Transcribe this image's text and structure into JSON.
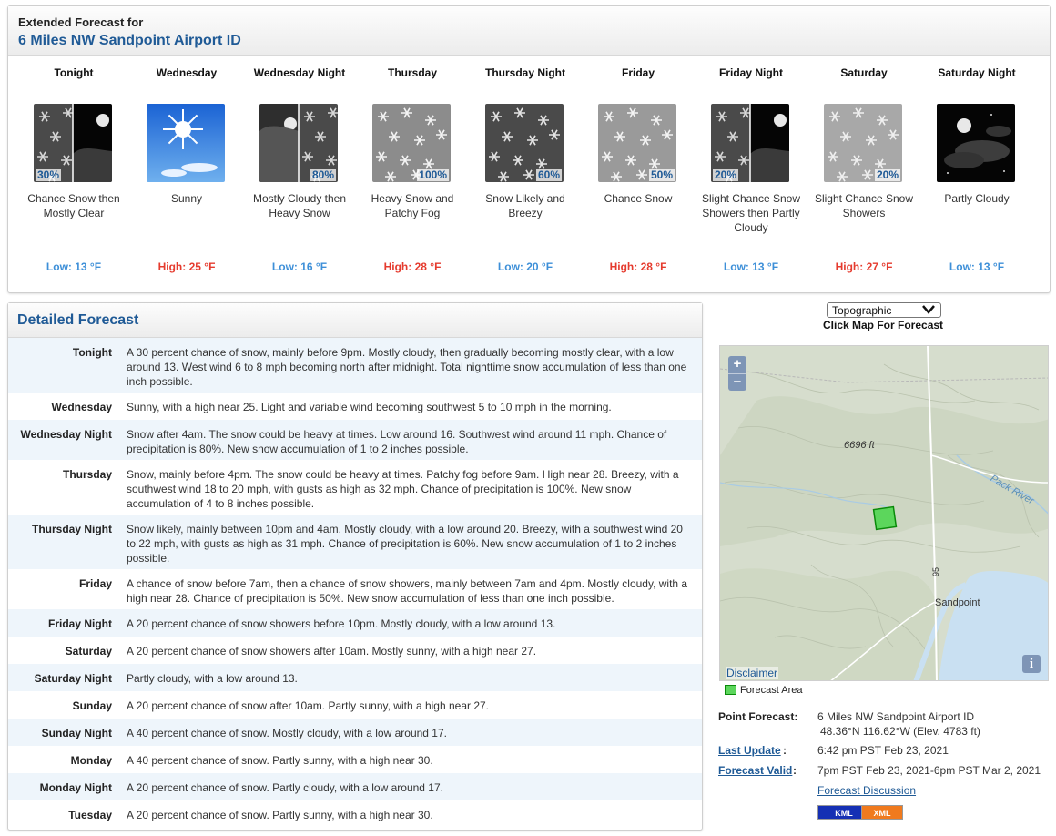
{
  "extended": {
    "label": "Extended Forecast for",
    "location": "6 Miles NW Sandpoint Airport ID",
    "periods": [
      {
        "name": "Tonight",
        "icon": "snow-then-clear-night-icon",
        "pct": "30%",
        "pct_side": "left",
        "desc": "Chance Snow then Mostly Clear",
        "temp": "Low: 13 °F",
        "temp_type": "low"
      },
      {
        "name": "Wednesday",
        "icon": "sunny-icon",
        "pct": "",
        "pct_side": "right",
        "desc": "Sunny",
        "temp": "High: 25 °F",
        "temp_type": "high"
      },
      {
        "name": "Wednesday Night",
        "icon": "cloudy-night-then-snow-icon",
        "pct": "80%",
        "pct_side": "right",
        "desc": "Mostly Cloudy then Heavy Snow",
        "temp": "Low: 16 °F",
        "temp_type": "low"
      },
      {
        "name": "Thursday",
        "icon": "heavy-snow-icon",
        "pct": "100%",
        "pct_side": "right",
        "desc": "Heavy Snow and Patchy Fog",
        "temp": "High: 28 °F",
        "temp_type": "high"
      },
      {
        "name": "Thursday Night",
        "icon": "snow-night-icon",
        "pct": "60%",
        "pct_side": "right",
        "desc": "Snow Likely and Breezy",
        "temp": "Low: 20 °F",
        "temp_type": "low"
      },
      {
        "name": "Friday",
        "icon": "snow-icon",
        "pct": "50%",
        "pct_side": "right",
        "desc": "Chance Snow",
        "temp": "High: 28 °F",
        "temp_type": "high"
      },
      {
        "name": "Friday Night",
        "icon": "snow-showers-then-partly-cloudy-night-icon",
        "pct": "20%",
        "pct_side": "left",
        "desc": "Slight Chance Snow Showers then Partly Cloudy",
        "temp": "Low: 13 °F",
        "temp_type": "low"
      },
      {
        "name": "Saturday",
        "icon": "snow-showers-icon",
        "pct": "20%",
        "pct_side": "right",
        "desc": "Slight Chance Snow Showers",
        "temp": "High: 27 °F",
        "temp_type": "high"
      },
      {
        "name": "Saturday Night",
        "icon": "partly-cloudy-night-icon",
        "pct": "",
        "pct_side": "right",
        "desc": "Partly Cloudy",
        "temp": "Low: 13 °F",
        "temp_type": "low"
      }
    ]
  },
  "detailed": {
    "title": "Detailed Forecast",
    "rows": [
      {
        "label": "Tonight",
        "text": "A 30 percent chance of snow, mainly before 9pm. Mostly cloudy, then gradually becoming mostly clear, with a low around 13. West wind 6 to 8 mph becoming north after midnight. Total nighttime snow accumulation of less than one inch possible."
      },
      {
        "label": "Wednesday",
        "text": "Sunny, with a high near 25. Light and variable wind becoming southwest 5 to 10 mph in the morning."
      },
      {
        "label": "Wednesday Night",
        "text": "Snow after 4am. The snow could be heavy at times. Low around 16. Southwest wind around 11 mph. Chance of precipitation is 80%. New snow accumulation of 1 to 2 inches possible."
      },
      {
        "label": "Thursday",
        "text": "Snow, mainly before 4pm. The snow could be heavy at times. Patchy fog before 9am. High near 28. Breezy, with a southwest wind 18 to 20 mph, with gusts as high as 32 mph. Chance of precipitation is 100%. New snow accumulation of 4 to 8 inches possible."
      },
      {
        "label": "Thursday Night",
        "text": "Snow likely, mainly between 10pm and 4am. Mostly cloudy, with a low around 20. Breezy, with a southwest wind 20 to 22 mph, with gusts as high as 31 mph. Chance of precipitation is 60%. New snow accumulation of 1 to 2 inches possible."
      },
      {
        "label": "Friday",
        "text": "A chance of snow before 7am, then a chance of snow showers, mainly between 7am and 4pm. Mostly cloudy, with a high near 28. Chance of precipitation is 50%. New snow accumulation of less than one inch possible."
      },
      {
        "label": "Friday Night",
        "text": "A 20 percent chance of snow showers before 10pm. Mostly cloudy, with a low around 13."
      },
      {
        "label": "Saturday",
        "text": "A 20 percent chance of snow showers after 10am. Mostly sunny, with a high near 27."
      },
      {
        "label": "Saturday Night",
        "text": "Partly cloudy, with a low around 13."
      },
      {
        "label": "Sunday",
        "text": "A 20 percent chance of snow after 10am. Partly sunny, with a high near 27."
      },
      {
        "label": "Sunday Night",
        "text": "A 40 percent chance of snow. Mostly cloudy, with a low around 17."
      },
      {
        "label": "Monday",
        "text": "A 40 percent chance of snow. Partly sunny, with a high near 30."
      },
      {
        "label": "Monday Night",
        "text": "A 20 percent chance of snow. Partly cloudy, with a low around 17."
      },
      {
        "label": "Tuesday",
        "text": "A 20 percent chance of snow. Partly sunny, with a high near 30."
      }
    ]
  },
  "map": {
    "select_value": "Topographic",
    "click_hint": "Click Map For Forecast",
    "zoom_in": "+",
    "zoom_out": "−",
    "elevation_label": "6696 ft",
    "river_label": "Pack River",
    "city_label": "Sandpoint",
    "road_label": "95",
    "disclaimer": "Disclaimer",
    "info": "i",
    "legend": "Forecast Area"
  },
  "point_info": {
    "point_forecast_label": "Point Forecast:",
    "point_forecast_value": "6 Miles NW Sandpoint Airport ID",
    "coords": "48.36°N 116.62°W (Elev. 4783 ft)",
    "last_update_label": "Last Update",
    "last_update_value": "6:42 pm PST Feb 23, 2021",
    "forecast_valid_label": "Forecast Valid",
    "forecast_valid_value": "7pm PST Feb 23, 2021-6pm PST Mar 2, 2021",
    "forecast_discussion": "Forecast Discussion",
    "kml": "KML",
    "xml": "XML"
  },
  "colors": {
    "link_blue": "#1f5a96",
    "low_temp": "#3d8fd8",
    "high_temp": "#e53b2e",
    "row_alt": "#eef5fb"
  }
}
